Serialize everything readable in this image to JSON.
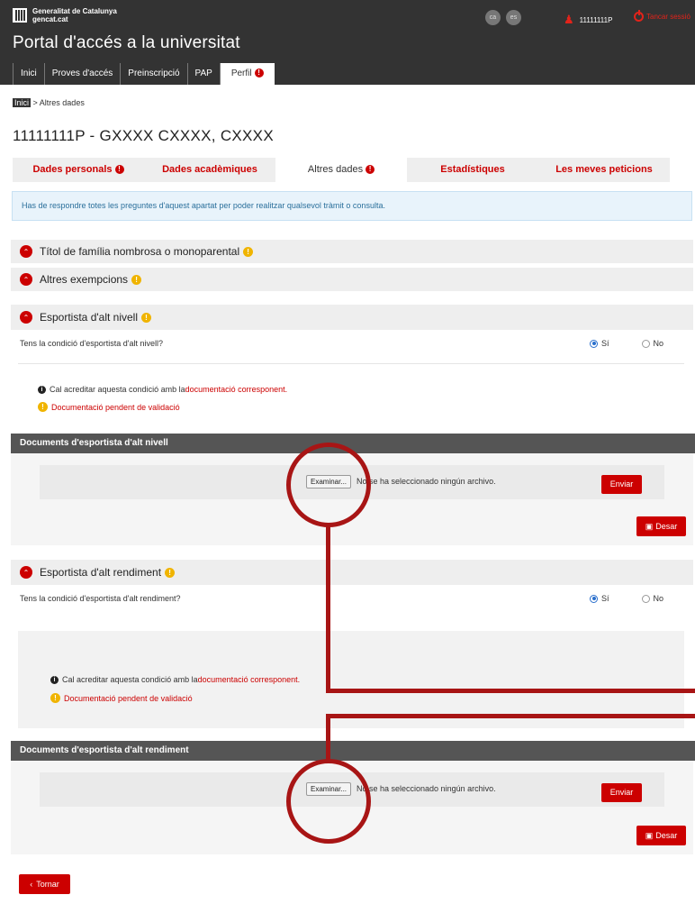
{
  "header": {
    "gencat_line1": "Generalitat de Catalunya",
    "gencat_line2": "gencat.cat",
    "lang_ca": "ca",
    "lang_es": "es",
    "user_id": "11111111P",
    "logout_label": "Tancar sessió",
    "portal_title": "Portal d'accés a la universitat",
    "nav": [
      "Inici",
      "Proves d'accés",
      "Preinscripció",
      "PAP",
      "Perfil"
    ]
  },
  "breadcrumb": {
    "home": "Inici",
    "current": "> Altres dades"
  },
  "page_title": "11111111P - GXXXX CXXXX, CXXXX",
  "tabs": [
    "Dades personals",
    "Dades acadèmiques",
    "Altres dades",
    "Estadístiques",
    "Les meves peticions"
  ],
  "info_message": "Has de respondre totes les preguntes d'aquest apartat per poder realitzar qualsevol tràmit o consulta.",
  "sections": {
    "familia": "Títol de família nombrosa o monoparental",
    "exempcions": "Altres exempcions",
    "alt_nivell": {
      "title": "Esportista d'alt nivell",
      "question": "Tens la condició d'esportista d'alt nivell?",
      "yes": "Sí",
      "no": "No",
      "note_prefix": "Cal acreditar aquesta condició amb la ",
      "note_link": "documentació corresponent.",
      "pending": "Documentació pendent de validació",
      "docs_title": "Documents d'esportista d'alt nivell",
      "file_button": "Examinar...",
      "file_status": "No se ha seleccionado ningún archivo.",
      "send": "Enviar",
      "save": "Desar"
    },
    "alt_rendiment": {
      "title": "Esportista d'alt rendiment",
      "question": "Tens la condició d'esportista d'alt rendiment?",
      "yes": "Sí",
      "no": "No",
      "note_prefix": "Cal acreditar aquesta condició amb la ",
      "note_link": "documentació corresponent.",
      "pending": "Documentació pendent de validació",
      "docs_title": "Documents d'esportista d'alt rendiment",
      "file_button": "Examinar...",
      "file_status": "No se ha seleccionado ningún archivo.",
      "send": "Enviar",
      "save": "Desar"
    }
  },
  "back_button": "Tornar",
  "colors": {
    "accent": "#cc0000",
    "header": "#333333",
    "annotation": "#a81515"
  }
}
